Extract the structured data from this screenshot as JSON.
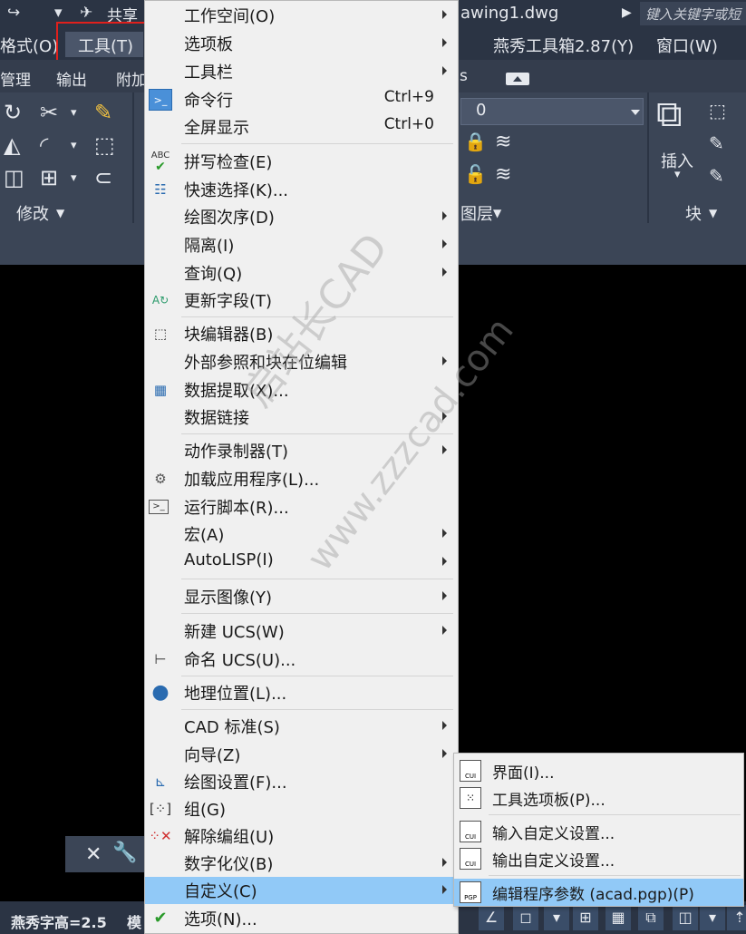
{
  "titlebar": {
    "share_label": "共享",
    "doc_title": "awing1.dwg",
    "search_placeholder": "键入关键字或短"
  },
  "menubar": {
    "items": [
      "格式(O)",
      "工具(T)",
      "燕秀工具箱2.87(Y)",
      "窗口(W)"
    ]
  },
  "ribbon_tabs": [
    "管理",
    "输出",
    "附加",
    "s"
  ],
  "ribbon": {
    "panels": [
      "修改",
      "图层",
      "块"
    ],
    "layer_value": "0",
    "insert_label": "插入"
  },
  "main_menu": {
    "items": [
      {
        "label": "工作空间(O)",
        "shortcut": "",
        "submenu": true,
        "icon": ""
      },
      {
        "label": "选项板",
        "shortcut": "",
        "submenu": true,
        "icon": ""
      },
      {
        "label": "工具栏",
        "shortcut": "",
        "submenu": true,
        "icon": ""
      },
      {
        "label": "命令行",
        "shortcut": "Ctrl+9",
        "submenu": false,
        "icon": "command-line-icon"
      },
      {
        "label": "全屏显示",
        "shortcut": "Ctrl+0",
        "submenu": false,
        "icon": ""
      },
      {
        "label": "拼写检查(E)",
        "shortcut": "",
        "submenu": false,
        "icon": "spell-check-icon"
      },
      {
        "label": "快速选择(K)...",
        "shortcut": "",
        "submenu": false,
        "icon": "quick-select-icon"
      },
      {
        "label": "绘图次序(D)",
        "shortcut": "",
        "submenu": true,
        "icon": ""
      },
      {
        "label": "隔离(I)",
        "shortcut": "",
        "submenu": true,
        "icon": ""
      },
      {
        "label": "查询(Q)",
        "shortcut": "",
        "submenu": true,
        "icon": ""
      },
      {
        "label": "更新字段(T)",
        "shortcut": "",
        "submenu": false,
        "icon": "update-field-icon"
      },
      {
        "label": "块编辑器(B)",
        "shortcut": "",
        "submenu": false,
        "icon": "block-editor-icon"
      },
      {
        "label": "外部参照和块在位编辑",
        "shortcut": "",
        "submenu": true,
        "icon": ""
      },
      {
        "label": "数据提取(X)...",
        "shortcut": "",
        "submenu": false,
        "icon": "data-extraction-icon"
      },
      {
        "label": "数据链接",
        "shortcut": "",
        "submenu": true,
        "icon": ""
      },
      {
        "label": "动作录制器(T)",
        "shortcut": "",
        "submenu": true,
        "icon": ""
      },
      {
        "label": "加载应用程序(L)...",
        "shortcut": "",
        "submenu": false,
        "icon": "load-app-icon"
      },
      {
        "label": "运行脚本(R)...",
        "shortcut": "",
        "submenu": false,
        "icon": "run-script-icon"
      },
      {
        "label": "宏(A)",
        "shortcut": "",
        "submenu": true,
        "icon": ""
      },
      {
        "label": "AutoLISP(I)",
        "shortcut": "",
        "submenu": true,
        "icon": ""
      },
      {
        "label": "显示图像(Y)",
        "shortcut": "",
        "submenu": true,
        "icon": ""
      },
      {
        "label": "新建 UCS(W)",
        "shortcut": "",
        "submenu": true,
        "icon": ""
      },
      {
        "label": "命名 UCS(U)...",
        "shortcut": "",
        "submenu": false,
        "icon": "named-ucs-icon"
      },
      {
        "label": "地理位置(L)...",
        "shortcut": "",
        "submenu": false,
        "icon": "globe-icon"
      },
      {
        "label": "CAD 标准(S)",
        "shortcut": "",
        "submenu": true,
        "icon": ""
      },
      {
        "label": "向导(Z)",
        "shortcut": "",
        "submenu": true,
        "icon": ""
      },
      {
        "label": "绘图设置(F)...",
        "shortcut": "",
        "submenu": false,
        "icon": "drafting-settings-icon"
      },
      {
        "label": "组(G)",
        "shortcut": "",
        "submenu": false,
        "icon": "group-icon"
      },
      {
        "label": "解除编组(U)",
        "shortcut": "",
        "submenu": false,
        "icon": "ungroup-icon"
      },
      {
        "label": "数字化仪(B)",
        "shortcut": "",
        "submenu": true,
        "icon": ""
      },
      {
        "label": "自定义(C)",
        "shortcut": "",
        "submenu": true,
        "icon": ""
      },
      {
        "label": "选项(N)...",
        "shortcut": "",
        "submenu": false,
        "icon": "checkmark-icon"
      }
    ]
  },
  "sub_menu": {
    "items": [
      {
        "label": "界面(I)...",
        "icon_text": "CUI"
      },
      {
        "label": "工具选项板(P)...",
        "icon_text": ""
      },
      {
        "label": "输入自定义设置...",
        "icon_text": "CUI"
      },
      {
        "label": "输出自定义设置...",
        "icon_text": "CUI"
      },
      {
        "label": "编辑程序参数 (acad.pgp)(P)",
        "icon_text": "PGP"
      }
    ]
  },
  "statusbar": {
    "text": "燕秀字高=2.5",
    "model_tab": "模"
  },
  "watermark": {
    "line1": "启站长CAD",
    "line2": "www.zzzcad.com"
  },
  "colors": {
    "menu_bg": "#f0f0f0",
    "menu_highlight": "#91c9f7",
    "highlight_box": "#e0201c",
    "titlebar": "#2b3444",
    "ribbon": "#3b4556"
  }
}
